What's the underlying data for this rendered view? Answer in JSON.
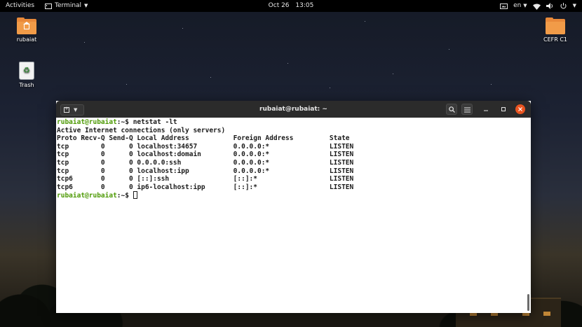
{
  "topbar": {
    "activities": "Activities",
    "app_menu": "Terminal",
    "date": "Oct 26",
    "time": "13:05",
    "language": "en"
  },
  "desktop": {
    "icons": [
      {
        "label": "rubaiat",
        "icon": "home-folder-icon"
      },
      {
        "label": "Trash",
        "icon": "trash-icon"
      },
      {
        "label": "CEFR C1",
        "icon": "folder-icon"
      }
    ]
  },
  "terminal": {
    "title": "rubaiat@rubaiat: ~",
    "prompt1": "rubaiat@rubaiat",
    "prompt_suffix1": ":~$ ",
    "command": "netstat -lt",
    "output_header": "Active Internet connections (only servers)",
    "table_header": "Proto Recv-Q Send-Q Local Address           Foreign Address         State",
    "rows": [
      "tcp        0      0 localhost:34657         0.0.0.0:*               LISTEN",
      "tcp        0      0 localhost:domain        0.0.0.0:*               LISTEN",
      "tcp        0      0 0.0.0.0:ssh             0.0.0.0:*               LISTEN",
      "tcp        0      0 localhost:ipp           0.0.0.0:*               LISTEN",
      "tcp6       0      0 [::]:ssh                [::]:*                  LISTEN",
      "tcp6       0      0 ip6-localhost:ipp       [::]:*                  LISTEN"
    ],
    "prompt2": "rubaiat@rubaiat",
    "prompt_suffix2": ":~$ "
  },
  "colors": {
    "accent": "#e95420",
    "folder": "#f19b48",
    "prompt_green": "#4e9a06"
  }
}
